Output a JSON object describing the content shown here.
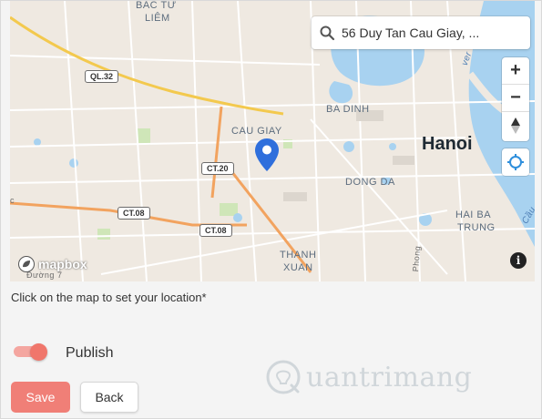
{
  "map": {
    "search_value": "56 Duy Tan Cau Giay, ...",
    "labels": {
      "bac_tu_liem_1": "BẮC TỪ",
      "bac_tu_liem_2": "LIÊM",
      "cau_giay": "CAU GIAY",
      "ba_dinh": "BA DINH",
      "hanoi": "Hanoi",
      "dong_da": "DONG DA",
      "hai_ba_trung_1": "HAI BA",
      "hai_ba_trung_2": "TRUNG",
      "thanh_xuan_1": "THANH",
      "thanh_xuan_2": "XUAN",
      "river_1": "ver",
      "river_2": "Cầu",
      "street_phong": "Phong",
      "street_duong": "Đường 7",
      "left_edge": "c"
    },
    "road_badges": {
      "ql32": "QL.32",
      "ct20": "CT.20",
      "ct08a": "CT.08",
      "ct08b": "CT.08"
    },
    "zoom_in": "+",
    "zoom_out": "−",
    "info": "i",
    "logo": "mapbox"
  },
  "hint": "Click on the map to set your location*",
  "publish": {
    "label": "Publish",
    "on": true
  },
  "buttons": {
    "save": "Save",
    "back": "Back"
  },
  "watermark": "uantrimang",
  "colors": {
    "accent": "#f07f77",
    "pin": "#2f6fdc",
    "water": "#a8d2f0"
  }
}
